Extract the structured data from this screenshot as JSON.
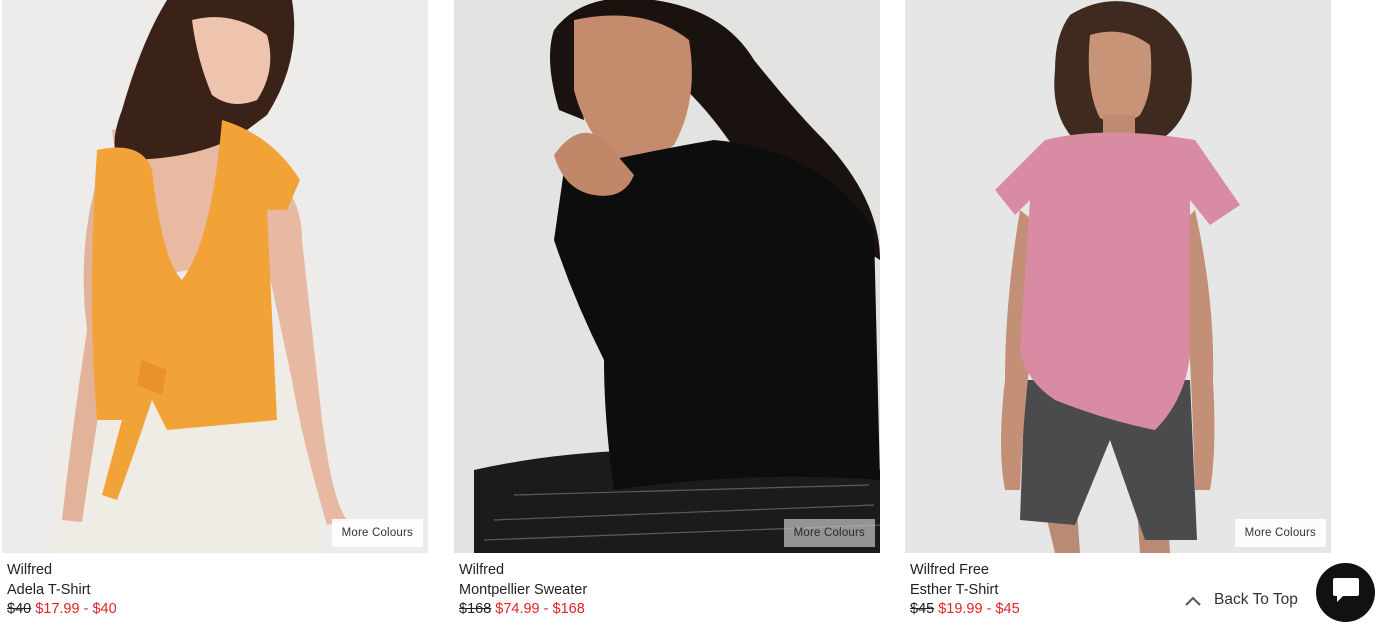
{
  "colors": {
    "sale": "#e32222",
    "text": "#222222",
    "chat_button": "#111111"
  },
  "products": [
    {
      "brand": "Wilfred",
      "name": "Adela T-Shirt",
      "old_price": "$40",
      "sale_price": "$17.99 - $40",
      "more_colours": "More Colours"
    },
    {
      "brand": "Wilfred",
      "name": "Montpellier Sweater",
      "old_price": "$168",
      "sale_price": "$74.99 - $168",
      "more_colours": "More Colours"
    },
    {
      "brand": "Wilfred Free",
      "name": "Esther T-Shirt",
      "old_price": "$45",
      "sale_price": "$19.99 - $45",
      "more_colours": "More Colours"
    }
  ],
  "back_to_top": {
    "label": "Back To Top",
    "icon": "chevron-up-icon"
  },
  "chat": {
    "icon": "chat-bubble-icon"
  }
}
